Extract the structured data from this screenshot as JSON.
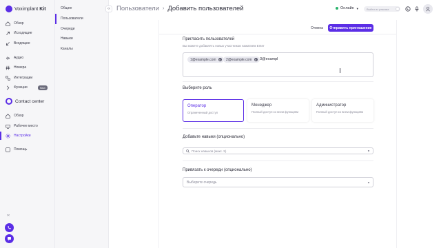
{
  "brand": {
    "name": "Voximplant",
    "suffix": "Kit",
    "accent": "#5b2ee6"
  },
  "sidebar": {
    "items": [
      {
        "label": "Обзор",
        "icon": "home-icon"
      },
      {
        "label": "Исходящие",
        "icon": "outgoing-icon"
      },
      {
        "label": "Входящие",
        "icon": "incoming-icon"
      },
      {
        "label": "Аудио",
        "icon": "audio-icon"
      },
      {
        "label": "Номера",
        "icon": "hash-icon"
      },
      {
        "label": "Интеграции",
        "icon": "integrations-icon"
      },
      {
        "label": "Функции",
        "icon": "function-icon",
        "badge": "New"
      }
    ],
    "contact_center": {
      "title": "Contact center",
      "items": [
        {
          "label": "Обзор",
          "icon": "home-icon"
        },
        {
          "label": "Рабочее место",
          "icon": "workplace-icon"
        },
        {
          "label": "Настройки",
          "icon": "gear-icon",
          "active": true
        },
        {
          "label": "Помощь",
          "icon": "help-icon"
        }
      ]
    },
    "collapse_icon": "expand-icon"
  },
  "subnav": {
    "items": [
      {
        "label": "Общее"
      },
      {
        "label": "Пользователи",
        "active": true
      },
      {
        "label": "Очереди"
      },
      {
        "label": "Навыки"
      },
      {
        "label": "Каналы"
      }
    ]
  },
  "header": {
    "breadcrumb_parent": "Пользователи",
    "breadcrumb_current": "Добавить пользователей",
    "status": "Онлайн",
    "status_color": "#29b36b",
    "toggle_label": "Выйти из режима",
    "icons": [
      "phone-icon",
      "mic-icon",
      "avatar"
    ]
  },
  "actions": {
    "cancel": "Отмена",
    "send": "Отправить приглашение"
  },
  "invite": {
    "title": "Пригласить пользователей",
    "hint": "Вы можете добавлять новых участников нажатием Enter",
    "chips": [
      "1@example.com",
      "2@example.com"
    ],
    "typed": "3@exampl"
  },
  "roles": {
    "title": "Выберите роль",
    "options": [
      {
        "name": "Оператор",
        "desc": "Ограниченный доступ",
        "selected": true
      },
      {
        "name": "Менеджер",
        "desc": "Полный доступ ко всем функциям"
      },
      {
        "name": "Администратор",
        "desc": "Полный доступ ко всем функциям"
      }
    ]
  },
  "skills": {
    "title": "Добавьте навыки (опционально)",
    "placeholder": "Поиск навыков (макс. 5)"
  },
  "queue": {
    "title": "Привязать к очереди (опционально)",
    "placeholder": "Выберите очередь"
  }
}
